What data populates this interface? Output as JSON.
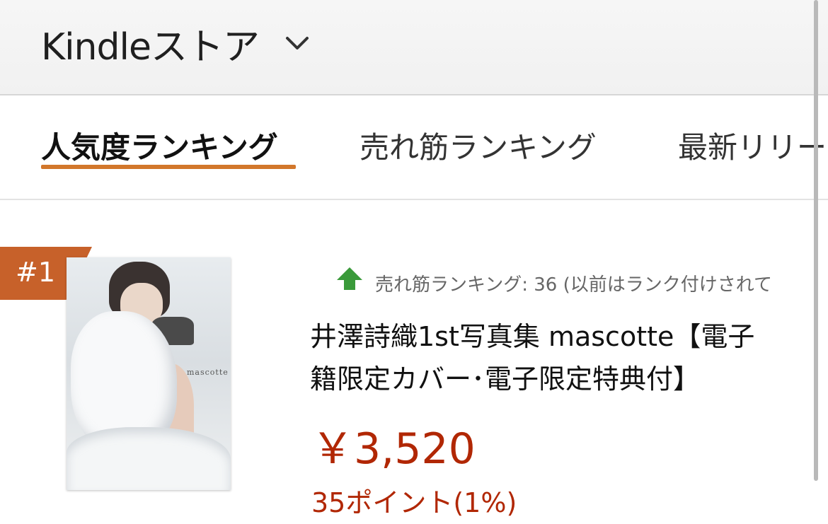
{
  "header": {
    "store_title": "Kindleストア",
    "dropdown_icon": "chevron-down-icon"
  },
  "tabs": [
    {
      "label": "人気度ランキング",
      "selected": true
    },
    {
      "label": "売れ筋ランキング",
      "selected": false
    },
    {
      "label": "最新リリー",
      "selected": false
    }
  ],
  "colors": {
    "accent": "#d2772b",
    "badge": "#c7612a",
    "price": "#b12704",
    "up_arrow": "#3a9a3a"
  },
  "product": {
    "rank_badge": "#1",
    "ranking_change_icon": "up-arrow-icon",
    "ranking_text": "売れ筋ランキング: 36 (以前はランク付けされて",
    "title_line1": "井澤詩織1st写真集 mascotte【電子",
    "title_line2": "籍限定カバー･電子限定特典付】",
    "price": "￥3,520",
    "points": "35ポイント(1%)",
    "cover_text": "mascotte"
  }
}
